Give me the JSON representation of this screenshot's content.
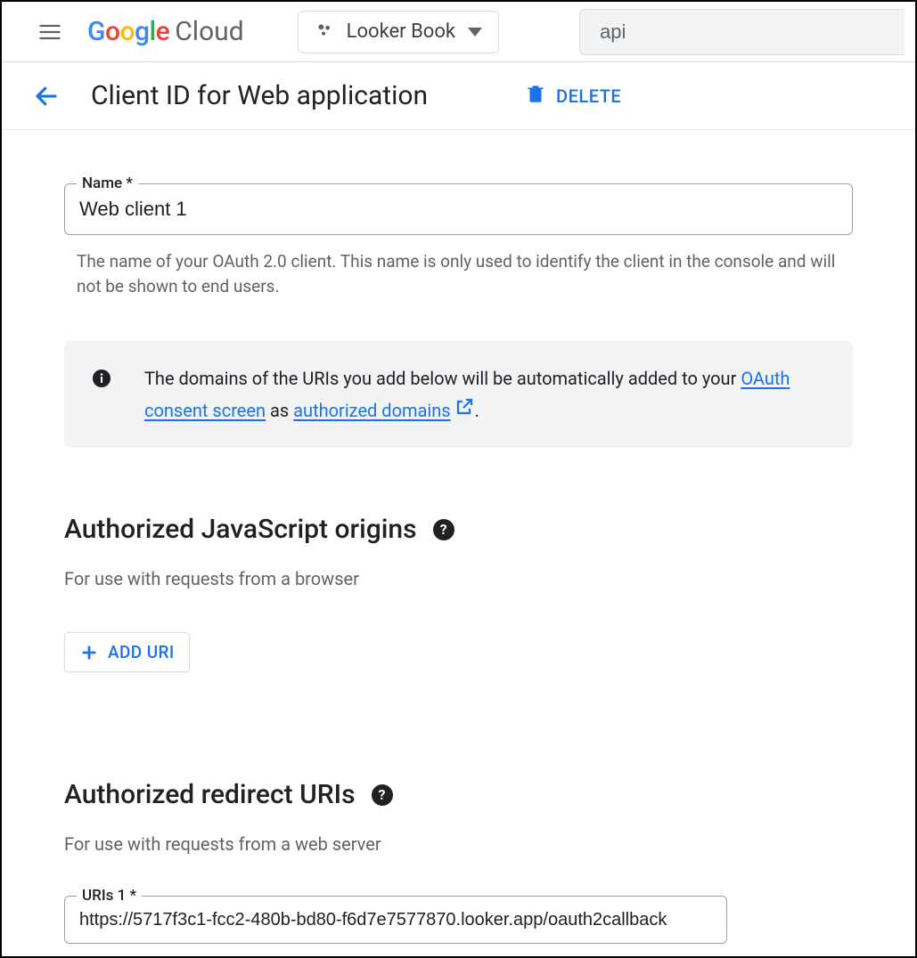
{
  "header": {
    "logo_google": "Google",
    "logo_cloud": "Cloud",
    "project_name": "Looker Book",
    "search_value": "api"
  },
  "subheader": {
    "title": "Client ID for Web application",
    "delete_label": "DELETE"
  },
  "name_field": {
    "label": "Name *",
    "value": "Web client 1",
    "help": "The name of your OAuth 2.0 client. This name is only used to identify the client in the console and will not be shown to end users."
  },
  "info_banner": {
    "text_before": "The domains of the URIs you add below will be automatically added to your ",
    "link1": "OAuth consent screen",
    "text_mid": " as ",
    "link2": "authorized domains",
    "text_after": "."
  },
  "js_origins": {
    "heading": "Authorized JavaScript origins",
    "sub": "For use with requests from a browser",
    "add_btn": "ADD URI"
  },
  "redirect_uris": {
    "heading": "Authorized redirect URIs",
    "sub": "For use with requests from a web server",
    "items": [
      {
        "label": "URIs 1 *",
        "value": "https://5717f3c1-fcc2-480b-bd80-f6d7e7577870.looker.app/oauth2callback"
      }
    ]
  }
}
